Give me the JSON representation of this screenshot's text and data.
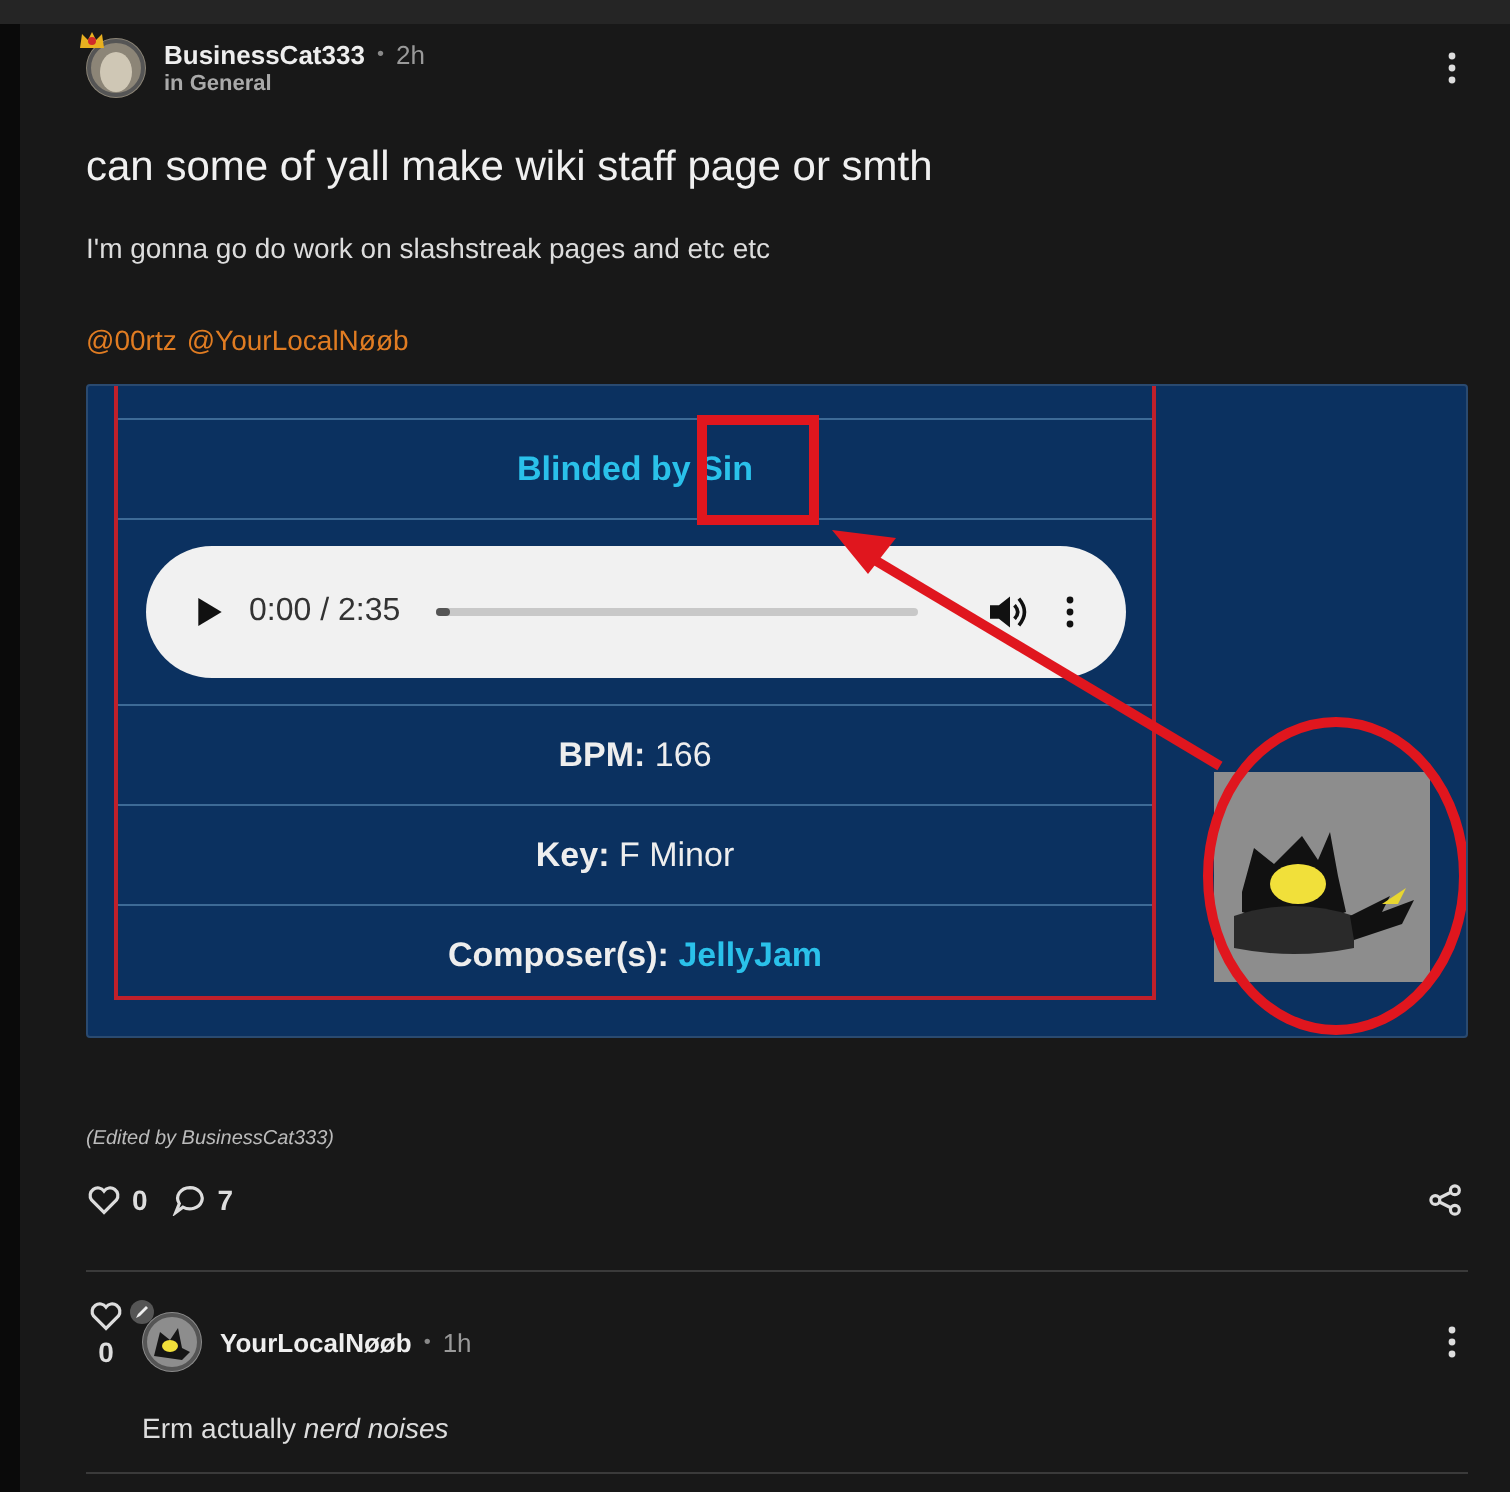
{
  "post": {
    "author": "BusinessCat333",
    "separator": "•",
    "time": "2h",
    "category": "in General",
    "title": "can some of yall make wiki staff page or smth",
    "body": "I'm gonna go do work on slashstreak pages and etc etc",
    "mentions": [
      "@00rtz",
      "@YourLocalNøøb"
    ],
    "embed": {
      "track_title": "Blinded by Sin",
      "player": {
        "time": "0:00 / 2:35",
        "level": 0.03
      },
      "rows": [
        {
          "label": "BPM:",
          "value": "166",
          "kind": "plain"
        },
        {
          "label": "Key:",
          "value": "F Minor",
          "kind": "plain"
        },
        {
          "label": "Composer(s):",
          "value": "JellyJam",
          "kind": "link"
        }
      ]
    },
    "edited": "(Edited by BusinessCat333)",
    "likes": "0",
    "comments": "7"
  },
  "reply": {
    "likes": "0",
    "author": "YourLocalNøøb",
    "separator": "•",
    "time": "1h",
    "body": "Erm actually *nerd noises*"
  }
}
